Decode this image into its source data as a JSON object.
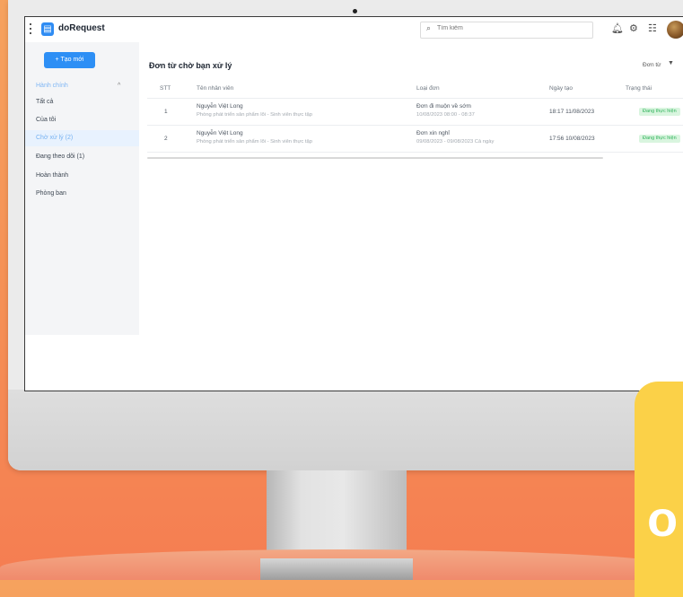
{
  "app": {
    "name": "doRequest",
    "logo_icon": "document-icon"
  },
  "search": {
    "placeholder": "Tìm kiếm"
  },
  "topbar_icons": [
    "bell-icon",
    "gear-icon",
    "grid-icon",
    "avatar"
  ],
  "sidebar": {
    "new_button": "+ Tạo mới",
    "group_label": "Hành chính",
    "items": [
      {
        "label": "Tất cả",
        "active": false
      },
      {
        "label": "Của tôi",
        "active": false
      },
      {
        "label": "Chờ xử lý (2)",
        "active": true
      },
      {
        "label": "Đang theo dõi (1)",
        "active": false
      },
      {
        "label": "Hoàn thành",
        "active": false
      },
      {
        "label": "Phòng ban",
        "active": false
      }
    ]
  },
  "main": {
    "title": "Đơn từ chờ bạn xử lý",
    "filter_label": "Đơn từ",
    "columns": [
      "STT",
      "Tên nhân viên",
      "Loại đơn",
      "Ngày tạo",
      "Trạng thái"
    ],
    "rows": [
      {
        "stt": "1",
        "name": "Nguyễn Việt Long",
        "dept": "Phòng phát triển sản phẩm lõi - Sinh viên thực tập",
        "type": "Đơn đi muộn về sớm",
        "type_detail": "10/08/2023 08:00 - 08:37",
        "created": "18:17 11/08/2023",
        "status": "Đang thực hiện"
      },
      {
        "stt": "2",
        "name": "Nguyễn Việt Long",
        "dept": "Phòng phát triển sản phẩm lõi - Sinh viên thực tập",
        "type": "Đơn xin nghỉ",
        "type_detail": "09/08/2023 - 09/08/2023 Cả ngày",
        "created": "17:56 10/08/2023",
        "status": "Đang thực hiện"
      }
    ]
  },
  "colors": {
    "accent": "#2d8ff5",
    "status_bg": "#d9f5df",
    "status_text": "#2fb25a",
    "background": "#f58f55",
    "promo": "#fbd148"
  }
}
